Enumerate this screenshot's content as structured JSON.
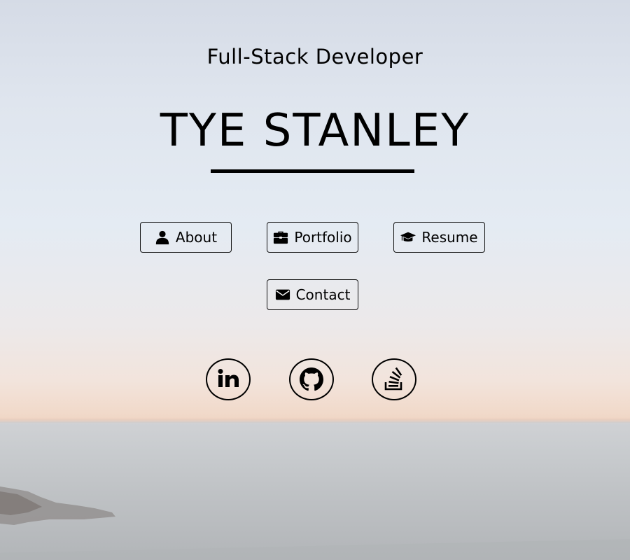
{
  "header": {
    "subtitle": "Full-Stack Developer",
    "name": "TYE STANLEY"
  },
  "nav": {
    "about_label": "About",
    "portfolio_label": "Portfolio",
    "resume_label": "Resume",
    "contact_label": "Contact",
    "about_icon": "user-icon",
    "portfolio_icon": "briefcase-icon",
    "resume_icon": "graduation-cap-icon",
    "contact_icon": "envelope-icon"
  },
  "social": {
    "links": [
      "linkedin-icon",
      "github-icon",
      "stackoverflow-icon"
    ]
  },
  "colors": {
    "text": "#000000",
    "sky_top": "#d5dbe6",
    "sky_sunset": "#f1d9c9",
    "sea": "#c9cccf"
  }
}
